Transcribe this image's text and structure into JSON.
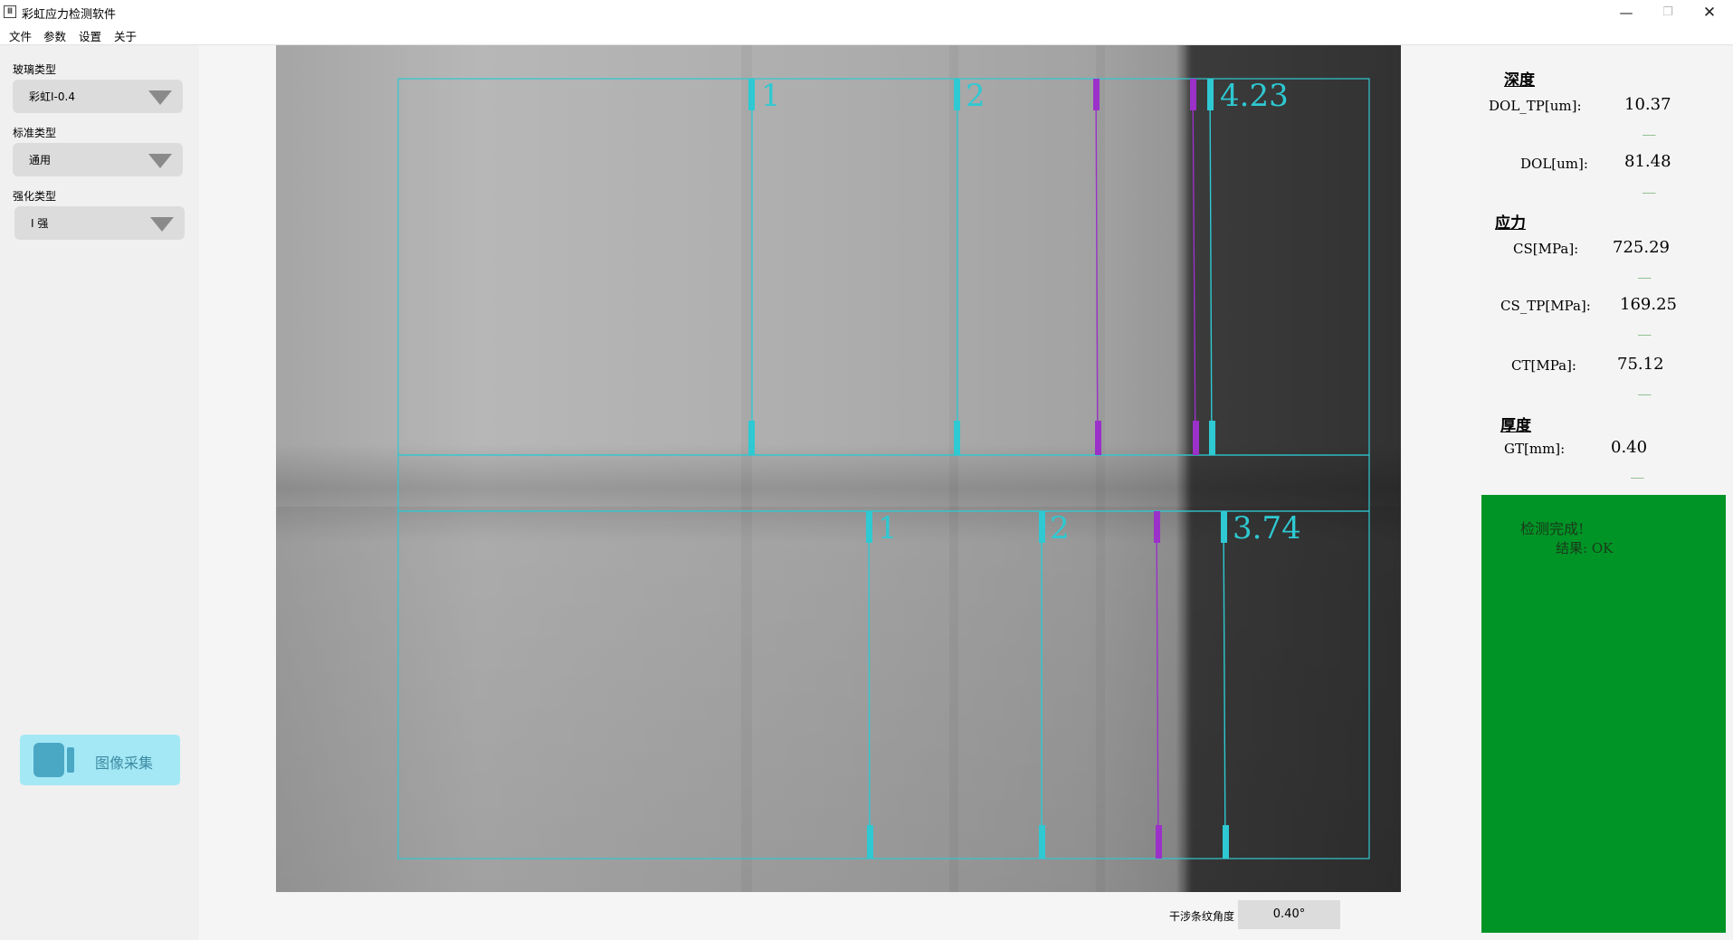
{
  "window": {
    "icon": "Ⅲ",
    "title": "彩虹应力检测软件",
    "controls": {
      "minimize": "—",
      "restore": "❐",
      "close": "✕"
    }
  },
  "menu": [
    "文件",
    "参数",
    "设置",
    "关于"
  ],
  "left_panel": {
    "glass_type": {
      "label": "玻璃类型",
      "value": "彩虹I-0.4"
    },
    "standard_type": {
      "label": "标准类型",
      "value": "通用"
    },
    "strengthen_type": {
      "label": "强化类型",
      "value": "I 强"
    },
    "capture_button": {
      "label": "图像采集",
      "icon": "camera-icon"
    }
  },
  "image_view": {
    "top_region": {
      "markers": [
        "1",
        "2"
      ],
      "result": "4.23"
    },
    "bottom_region": {
      "markers": [
        "1",
        "2"
      ],
      "result": "3.74"
    },
    "colors": {
      "box": "#2ec9d2",
      "purple": "#9b31c9"
    }
  },
  "right_panel": {
    "depth_title": "深度",
    "depth": [
      {
        "label": "DOL_TP[um]:",
        "value": "10.37",
        "dash": "__"
      },
      {
        "label": "DOL[um]:",
        "value": "81.48",
        "dash": "__"
      }
    ],
    "stress_title": "应力",
    "stress": [
      {
        "label": "CS[MPa]:",
        "value": "725.29",
        "dash": "__"
      },
      {
        "label": "CS_TP[MPa]:",
        "value": "169.25",
        "dash": "__"
      },
      {
        "label": "CT[MPa]:",
        "value": "75.12",
        "dash": "__"
      }
    ],
    "thickness_title": "厚度",
    "thickness": [
      {
        "label": "GT[mm]:",
        "value": "0.40",
        "dash": "__"
      }
    ],
    "status": {
      "line1": "检测完成!",
      "line2": "结果: OK",
      "color": "#009426"
    }
  },
  "bottom": {
    "angle_label": "干涉条纹角度",
    "angle_value": "0.40°"
  }
}
